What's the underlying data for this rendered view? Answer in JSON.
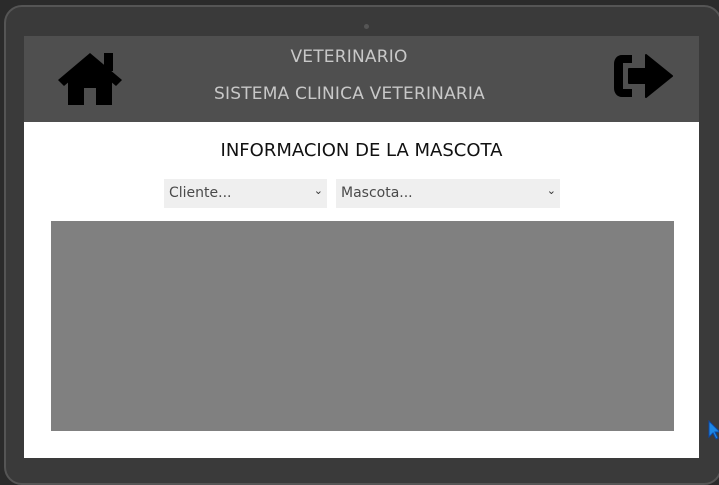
{
  "header": {
    "title": "VETERINARIO",
    "subtitle": "SISTEMA CLINICA VETERINARIA",
    "home_icon": "home-icon",
    "logout_icon": "sign-out-icon",
    "background_color": "#4f4f4f",
    "text_color": "#c8c8c8"
  },
  "main": {
    "title": "INFORMACION DE LA MASCOTA",
    "client_select": {
      "value": "Cliente..."
    },
    "pet_select": {
      "value": "Mascota..."
    },
    "panel_color": "#808080"
  }
}
